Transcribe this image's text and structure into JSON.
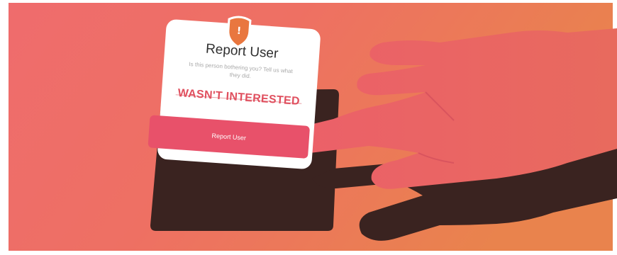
{
  "dialog": {
    "title": "Report User",
    "subtitle": "Is this person bothering you? Tell us what they did.",
    "reason": "WASN'T INTERESTED",
    "action_label": "Report User",
    "alert_symbol": "!",
    "alert_icon": "alert-shield-icon"
  },
  "colors": {
    "background_left": "#ee6d6a",
    "background_right": "#e9824e",
    "card": "#ffffff",
    "accent": "#e8516a",
    "badge": "#e9773f",
    "shadow": "#3a2320",
    "finger": "#ea5d68"
  }
}
